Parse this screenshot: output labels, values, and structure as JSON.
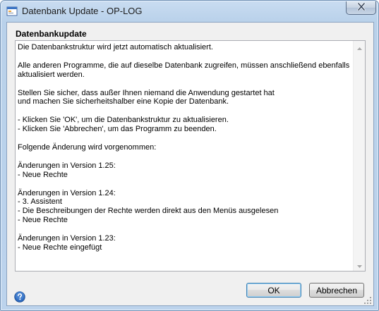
{
  "window": {
    "title": "Datenbank Update - OP-LOG",
    "icon": "app-window-icon",
    "close_icon": "close-icon"
  },
  "section": {
    "title": "Datenbankupdate"
  },
  "message": {
    "text": "Die Datenbankstruktur wird jetzt automatisch aktualisiert.\n\nAlle anderen Programme, die auf dieselbe Datenbank zugreifen, müssen anschließend ebenfalls aktualisiert werden.\n\nStellen Sie sicher, dass außer Ihnen niemand die Anwendung gestartet hat\nund machen Sie sicherheitshalber eine Kopie der Datenbank.\n\n- Klicken Sie 'OK', um die Datenbankstruktur zu aktualisieren.\n- Klicken Sie 'Abbrechen', um das Programm zu beenden.\n\nFolgende Änderung wird vorgenommen:\n\nÄnderungen in Version 1.25:\n- Neue Rechte\n\nÄnderungen in Version 1.24:\n- 3. Assistent\n- Die Beschreibungen der Rechte werden direkt aus den Menüs ausgelesen\n- Neue Rechte\n\nÄnderungen in Version 1.23:\n- Neue Rechte eingefügt"
  },
  "buttons": {
    "ok_label": "OK",
    "cancel_label": "Abbrechen"
  },
  "icons": {
    "help": "help-icon",
    "scroll_up": "scroll-up-arrow-icon",
    "scroll_down": "scroll-down-arrow-icon",
    "grip": "resize-grip-icon"
  },
  "colors": {
    "title_bar": "#bcd3ec",
    "client_background": "#f0f0f0",
    "ok_button_border": "#3c7fb1"
  }
}
